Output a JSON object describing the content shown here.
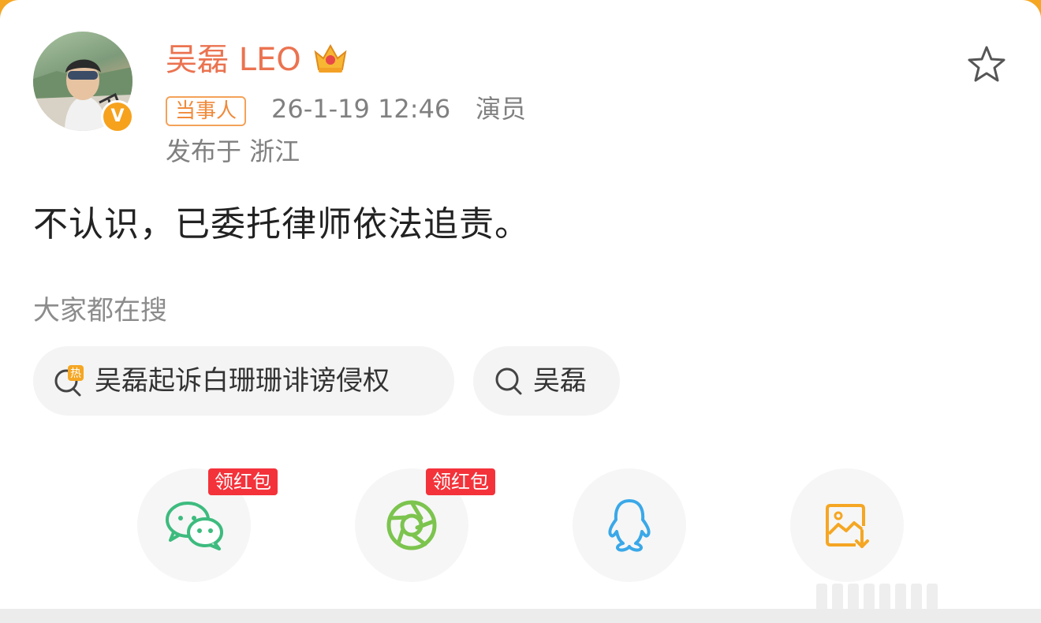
{
  "user": {
    "name": "吴磊 LEO",
    "badge_icon": "crown-icon",
    "verified_icon": "verified-v-icon"
  },
  "post": {
    "tag": "当事人",
    "time": "26-1-19 12:46",
    "role": "演员",
    "location": "发布于 浙江",
    "text": "不认识，已委托律师依法追责。"
  },
  "search": {
    "heading": "大家都在搜",
    "chips": [
      {
        "label": "吴磊起诉白珊珊诽谤侵权",
        "icon": "hot-search-icon"
      },
      {
        "label": "吴磊",
        "icon": "search-icon"
      }
    ]
  },
  "share": {
    "items": [
      {
        "icon": "wechat-icon",
        "badge": "领红包"
      },
      {
        "icon": "moments-icon",
        "badge": "领红包"
      },
      {
        "icon": "qq-icon"
      },
      {
        "icon": "save-image-icon"
      }
    ]
  },
  "colors": {
    "username": "#eb7350",
    "accent_orange": "#f08a3a",
    "red_badge": "#f4323a",
    "wechat_green": "#3dbb7e",
    "qq_blue": "#3aa8e8",
    "save_orange": "#f5a623"
  }
}
